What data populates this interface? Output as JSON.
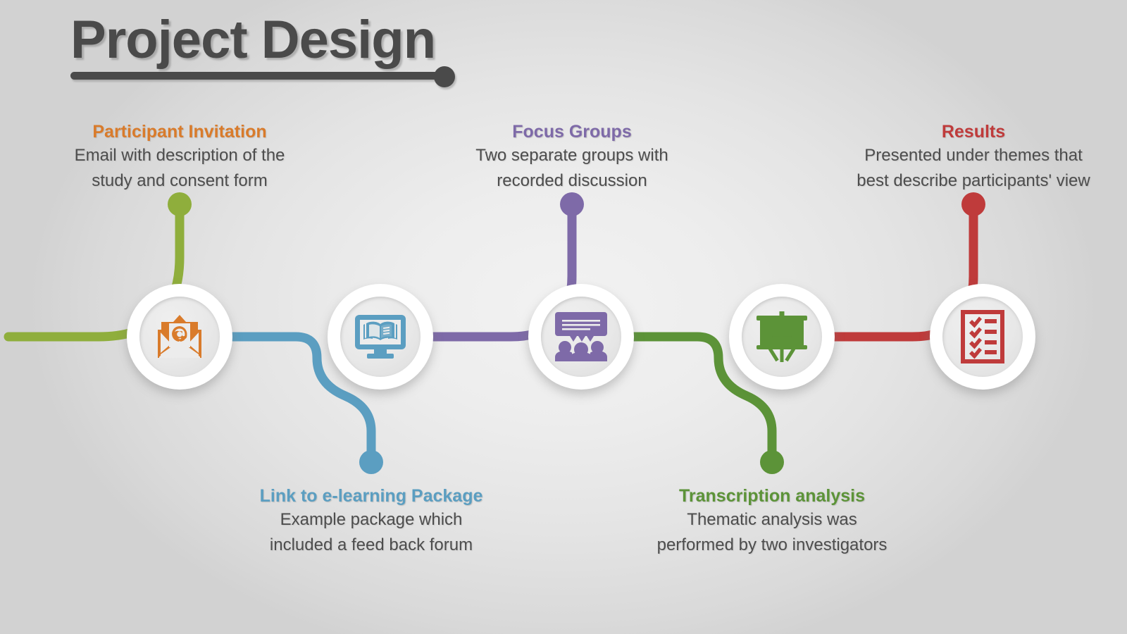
{
  "title": {
    "text": "Project Design",
    "color": "#4a4a4a"
  },
  "colors": {
    "step1": "#8fae3c",
    "step2": "#5b9ec1",
    "step3": "#7e6aa8",
    "step4": "#5c9338",
    "step5": "#bf3b3b",
    "icon1": "#d97b2b",
    "icon2": "#5b9ec1",
    "icon3": "#7e6aa8",
    "icon4": "#5c9338",
    "icon5": "#bf3b3b",
    "background": "#e7e7e7",
    "body_text": "#4d4d4d"
  },
  "steps": [
    {
      "id": "participant-invitation",
      "title": "Participant Invitation",
      "desc_lines": [
        "Email with description of the",
        "study and consent form"
      ],
      "title_color": "#d97b2b",
      "line_color": "#8fae3c",
      "icon": "email-envelope-icon",
      "icon_color": "#d97b2b",
      "position": "above"
    },
    {
      "id": "link-to-elearning-package",
      "title": "Link to e-learning Package",
      "desc_lines": [
        "Example package which",
        "included a feed back forum"
      ],
      "title_color": "#5b9ec1",
      "line_color": "#5b9ec1",
      "icon": "monitor-book-icon",
      "icon_color": "#5b9ec1",
      "position": "below"
    },
    {
      "id": "focus-groups",
      "title": "Focus Groups",
      "desc_lines": [
        "Two separate groups with",
        "recorded discussion"
      ],
      "title_color": "#7e6aa8",
      "line_color": "#7e6aa8",
      "icon": "speech-bubble-people-icon",
      "icon_color": "#7e6aa8",
      "position": "above"
    },
    {
      "id": "transcription-analysis",
      "title": "Transcription analysis",
      "desc_lines": [
        "Thematic analysis was",
        "performed by two investigators"
      ],
      "title_color": "#5c9338",
      "line_color": "#5c9338",
      "icon": "presentation-chart-icon",
      "icon_color": "#5c9338",
      "position": "below"
    },
    {
      "id": "results",
      "title": "Results",
      "desc_lines": [
        "Presented under themes that",
        "best describe participants' view"
      ],
      "title_color": "#bf3b3b",
      "line_color": "#bf3b3b",
      "icon": "checklist-clipboard-icon",
      "icon_color": "#bf3b3b",
      "position": "above"
    }
  ]
}
